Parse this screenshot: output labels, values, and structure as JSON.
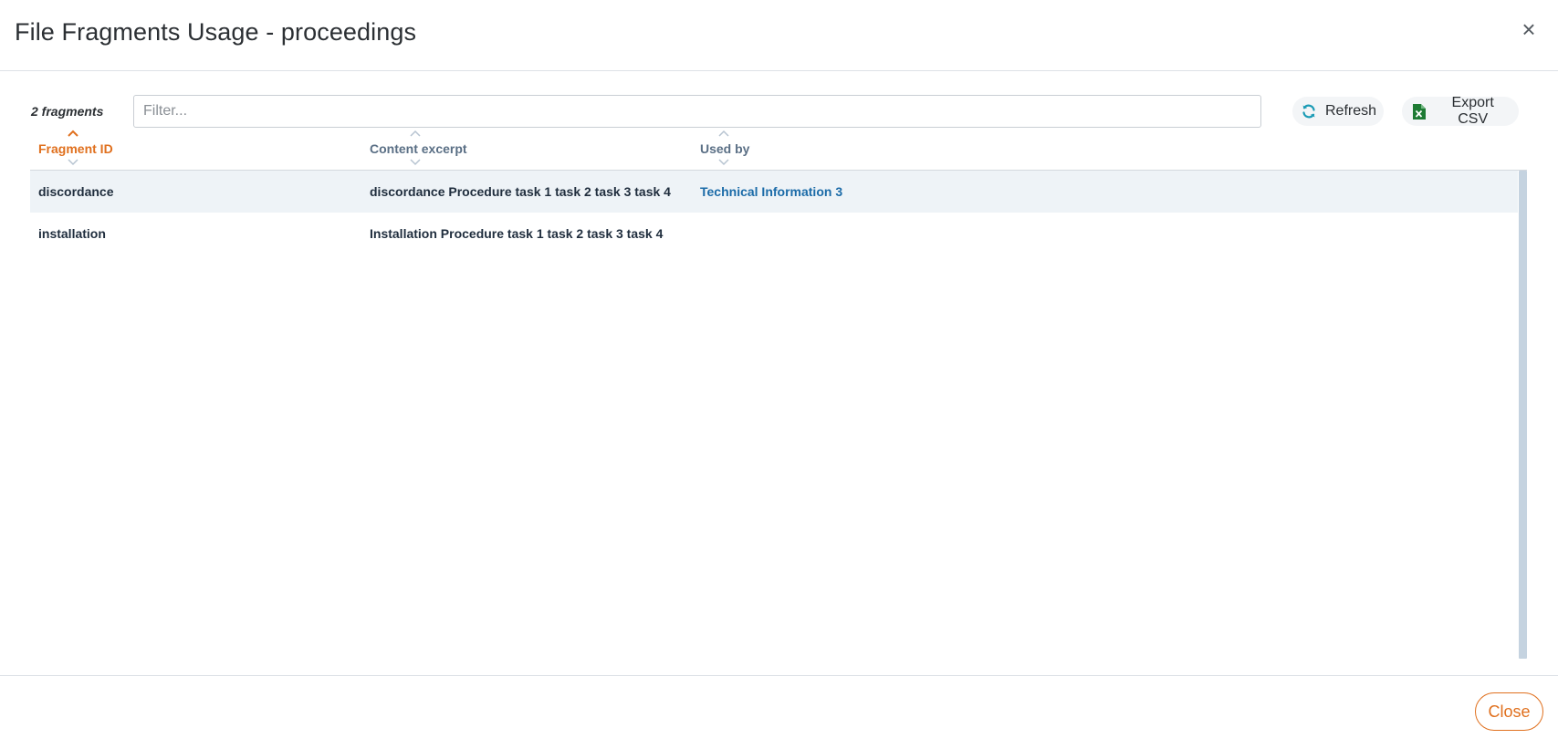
{
  "dialog": {
    "title": "File Fragments Usage - proceedings",
    "close_icon": "×"
  },
  "toolbar": {
    "count_label": "2 fragments",
    "filter_placeholder": "Filter...",
    "filter_value": "",
    "refresh_label": "Refresh",
    "export_label": "Export CSV"
  },
  "table": {
    "columns": [
      {
        "label": "Fragment ID",
        "sorted": "asc"
      },
      {
        "label": "Content excerpt",
        "sorted": "none"
      },
      {
        "label": "Used by",
        "sorted": "none"
      }
    ],
    "rows": [
      {
        "fragment_id": "discordance",
        "content": "discordance Procedure task 1 task 2 task 3 task 4",
        "used_by": "Technical Information 3"
      },
      {
        "fragment_id": "installation",
        "content": "Installation Procedure task 1 task 2 task 3 task 4",
        "used_by": ""
      }
    ]
  },
  "footer": {
    "close_label": "Close"
  },
  "colors": {
    "accent": "#e0701e",
    "link": "#1b6ba8",
    "row_highlight": "#eef3f7",
    "header_label": "#5a6f85"
  },
  "icons": {
    "refresh": "refresh-icon",
    "export": "excel-file-icon",
    "close": "close-icon",
    "sort_up": "chevron-up-icon",
    "sort_down": "chevron-down-icon"
  }
}
